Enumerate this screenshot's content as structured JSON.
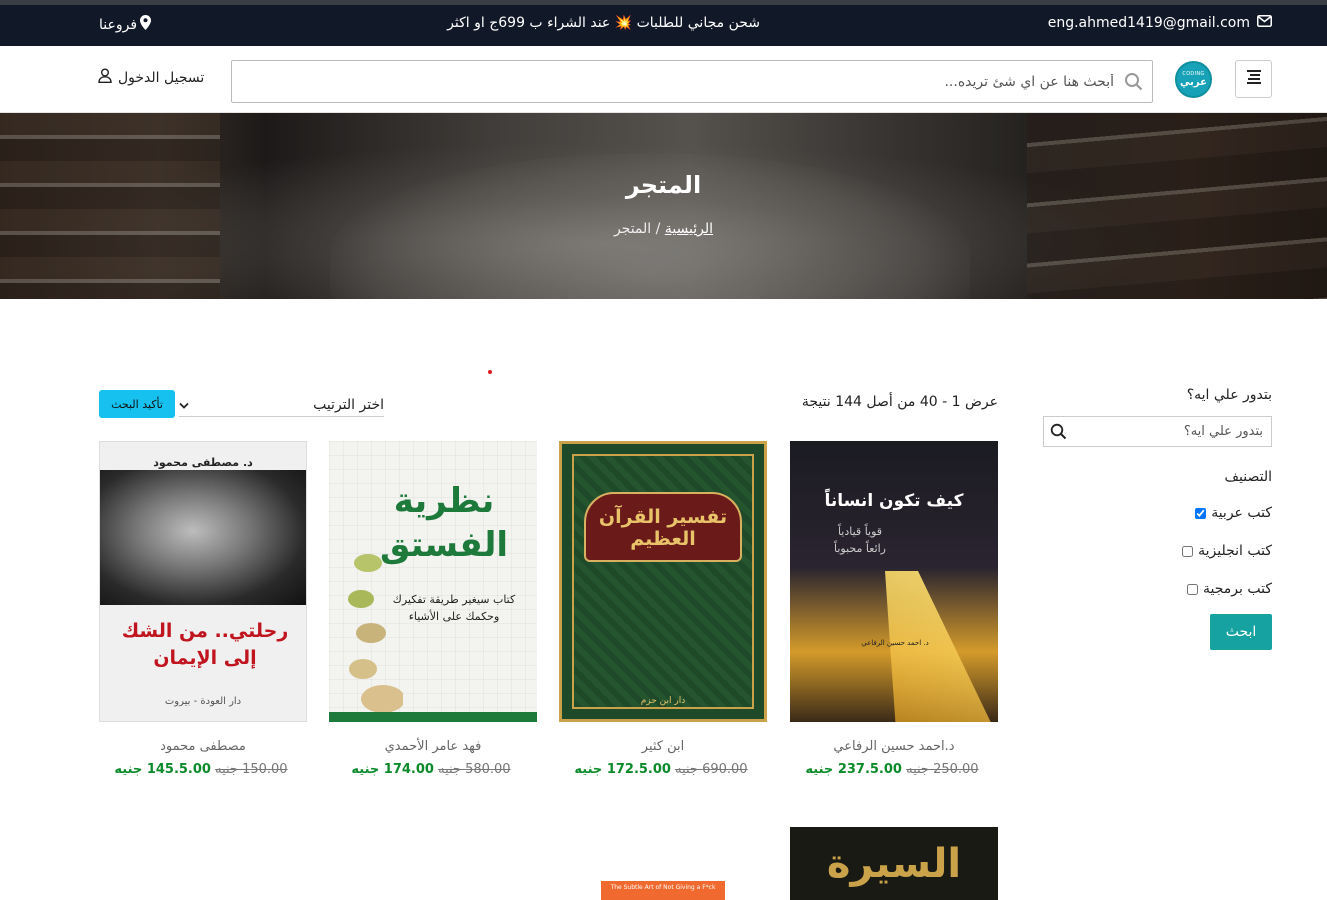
{
  "topbar": {
    "email": "eng.ahmed1419@gmail.com",
    "promo": "شحن مجاني للطلبات 💥 عند الشراء ب 699ج او اكثر",
    "branches": "فروعنا"
  },
  "header": {
    "logo_top": "CODING",
    "logo_bottom": "عربي",
    "search_placeholder": "أبحث هنا عن اي شئ تريده...",
    "login": "تسجيل الدخول"
  },
  "hero": {
    "title": "المتجر",
    "breadcrumb_home": "الرئيسية",
    "breadcrumb_sep": "/",
    "breadcrumb_current": "المتجر"
  },
  "sidebar": {
    "question": "بتدور علي ايه؟",
    "search_placeholder": "بتدور علي ايه؟",
    "category_title": "التصنيف",
    "categories": [
      {
        "label": "كتب عربية",
        "checked": true
      },
      {
        "label": "كتب انجليزية",
        "checked": false
      },
      {
        "label": "كتب برمجية",
        "checked": false
      }
    ],
    "search_button": "ابحث"
  },
  "toolbar": {
    "results_text": "عرض 1 - 40 من أصل 144 نتيجة",
    "sort_label": "اختر الترتيب",
    "confirm_button": "تأكيد البحث"
  },
  "products": [
    {
      "author": "د.احمد حسين الرفاعي",
      "old_price": "250.00 جنيه",
      "new_price": "237.5.00 جنيه",
      "cover_title": "كيف تكون انساناً",
      "cover_sub": "قوياً قيادياً رائعاً محبوباً",
      "cover_author": "د. احمد حسين الرفاعي"
    },
    {
      "author": "ابن كثير",
      "old_price": "690.00 جنيه",
      "new_price": "172.5.00 جنيه",
      "cover_title": "تفسير القرآن العظيم",
      "cover_sub": "دار ابن حزم"
    },
    {
      "author": "فهد عامر الأحمدي",
      "old_price": "580.00 جنيه",
      "new_price": "174.00 جنيه",
      "cover_title": "نظرية الفستق",
      "cover_sub": "كتاب سيغير طريقة تفكيرك وحكمك على الأشياء"
    },
    {
      "author": "مصطفى محمود",
      "old_price": "150.00 جنيه",
      "new_price": "145.5.00 جنيه",
      "cover_title": "رحلتي.. من الشك إلى الإيمان",
      "cover_author": "د. مصطفى محمود",
      "cover_pub": "دار العودة - بيروت"
    }
  ],
  "partial_products": [
    {
      "cover_title": "السيرة"
    },
    {
      "cover_title": "The Subtle Art of Not Giving a F*ck"
    }
  ]
}
